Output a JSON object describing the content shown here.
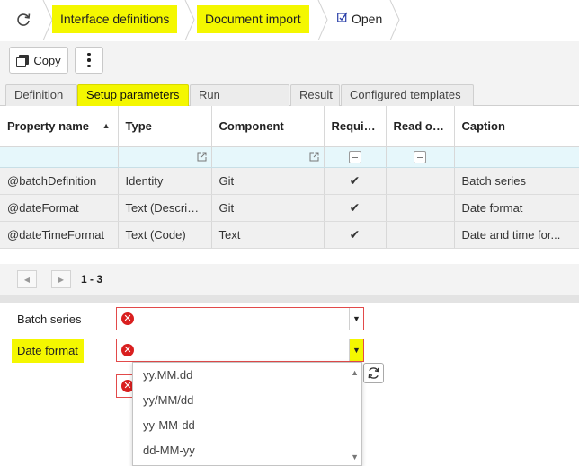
{
  "breadcrumb": {
    "items": [
      {
        "label": "Interface definitions"
      },
      {
        "label": "Document import"
      },
      {
        "label": "Open"
      }
    ]
  },
  "toolbar": {
    "copy_label": "Copy"
  },
  "tabs": [
    {
      "label": "Definition",
      "active": false
    },
    {
      "label": "Setup parameters",
      "active": true
    },
    {
      "label": "Run parameters",
      "active": false
    },
    {
      "label": "Result",
      "active": false
    },
    {
      "label": "Configured templates",
      "active": false
    }
  ],
  "grid": {
    "columns": [
      "Property name",
      "Type",
      "Component",
      "Required",
      "Read only",
      "Caption"
    ],
    "sorted_column": "Property name",
    "sort_direction": "ascending",
    "rows": [
      {
        "property": "@batchDefinition",
        "type": "Identity",
        "component": "Git",
        "required": "✔",
        "read_only": "",
        "caption": "Batch series"
      },
      {
        "property": "@dateFormat",
        "type": "Text (Descript...",
        "component": "Git",
        "required": "✔",
        "read_only": "",
        "caption": "Date format"
      },
      {
        "property": "@dateTimeFormat",
        "type": "Text (Code)",
        "component": "Text",
        "required": "✔",
        "read_only": "",
        "caption": "Date and time for..."
      }
    ]
  },
  "pager": {
    "range": "1 - 3"
  },
  "form": {
    "batch_series_label": "Batch series",
    "date_format_label": "Date format",
    "dropdown_options": [
      "yy.MM.dd",
      "yy/MM/dd",
      "yy-MM-dd",
      "dd-MM-yy"
    ]
  },
  "colors": {
    "highlight": "#f4f700",
    "error": "#d91f1f",
    "filter_row": "#e6f7fb"
  }
}
